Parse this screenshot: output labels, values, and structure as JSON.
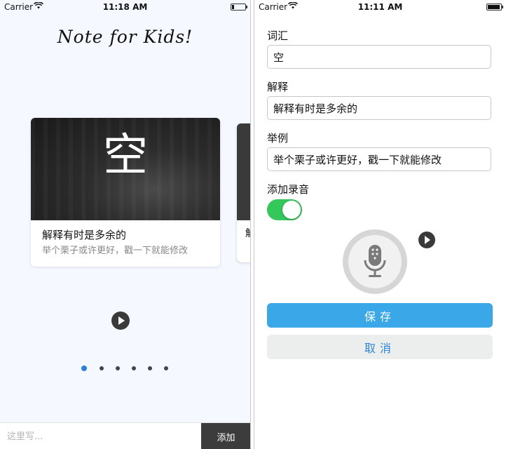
{
  "left_screen": {
    "status": {
      "carrier": "Carrier",
      "time": "11:18 AM"
    },
    "title": "Note for Kids!",
    "card": {
      "character": "空",
      "explanation": "解释有时是多余的",
      "example": "举个栗子或许更好，戳一下就能修改"
    },
    "peek_card_text": "解",
    "pagination": {
      "count": 6,
      "active": 1
    },
    "bottom_bar": {
      "placeholder": "这里写...",
      "add_label": "添加"
    }
  },
  "right_screen": {
    "status": {
      "carrier": "Carrier",
      "time": "11:11 AM"
    },
    "word": {
      "label": "词汇",
      "value": "空"
    },
    "explanation": {
      "label": "解释",
      "value": "解释有时是多余的"
    },
    "example": {
      "label": "举例",
      "value": "举个栗子或许更好，戳一下就能修改"
    },
    "recording": {
      "label": "添加录音",
      "enabled": true
    },
    "save_label": "保存",
    "cancel_label": "取消"
  },
  "colors": {
    "accent_blue": "#3aa7e8",
    "toggle_green": "#34c759",
    "cancel_text": "#2a86e0",
    "dark_button": "#3c3c3c"
  },
  "icons": [
    "wifi-icon",
    "battery-icon",
    "play-icon",
    "microphone-icon"
  ]
}
